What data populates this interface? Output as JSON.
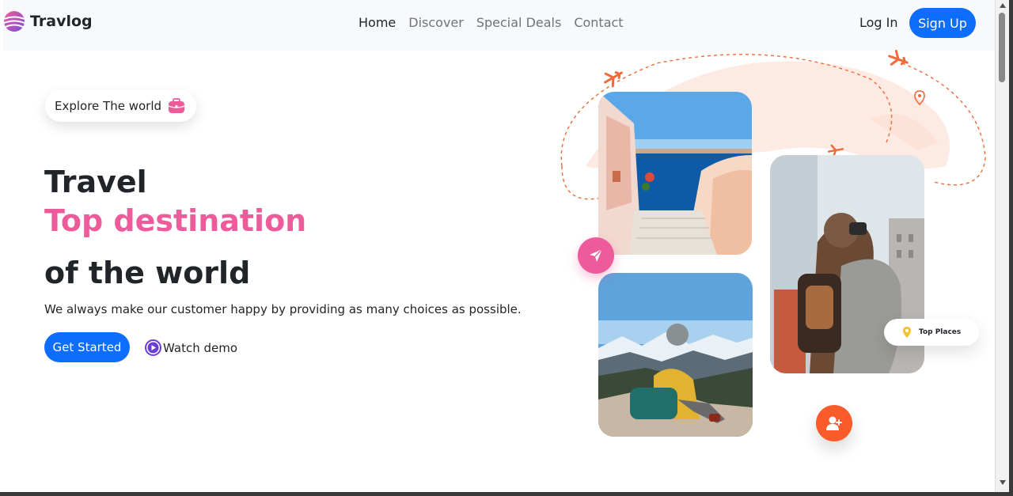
{
  "nav": {
    "brand": "Travlog",
    "links": [
      {
        "label": "Home"
      },
      {
        "label": "Discover"
      },
      {
        "label": "Special Deals"
      },
      {
        "label": "Contact"
      }
    ],
    "login": "Log In",
    "signup": "Sign Up"
  },
  "hero": {
    "badge": "Explore The world",
    "title_line1": "Travel",
    "title_line2": "Top destination",
    "title_line3": "of the world",
    "subtitle": "We always make our customer happy by providing as many choices as possible.",
    "cta": "Get Started",
    "watch": "Watch demo",
    "top_places": "Top Places"
  },
  "colors": {
    "primary": "#0d6efd",
    "pink": "#ee5b9a",
    "orange": "#fb5a2a",
    "navbar_bg": "#f8f9fa"
  },
  "icons": [
    "logo-icon",
    "briefcase-icon",
    "play-icon",
    "send-icon",
    "add-user-icon",
    "location-pin-icon",
    "airplane-icon"
  ]
}
